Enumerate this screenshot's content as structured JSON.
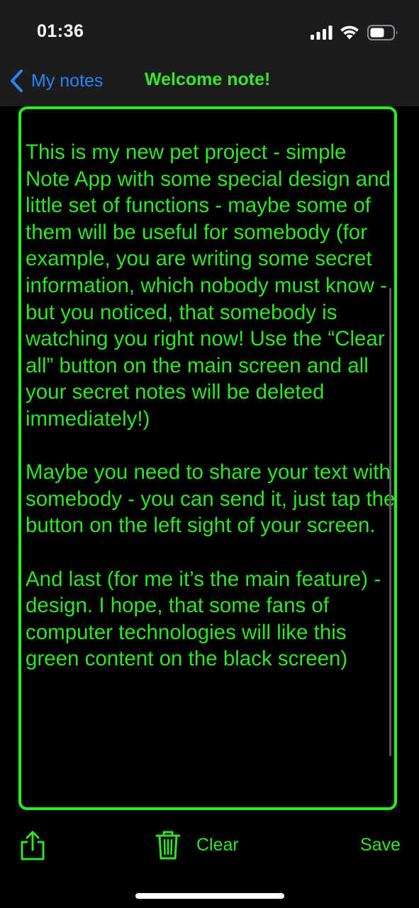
{
  "status_bar": {
    "time": "01:36",
    "icons": [
      "signal-icon",
      "wifi-icon",
      "battery-icon"
    ]
  },
  "nav": {
    "back_label": "My notes",
    "back_icon": "chevron-left-icon",
    "title": "Welcome note!"
  },
  "note": {
    "text": "This is my new pet project - simple Note App with some special design and little set of functions - maybe some of them will be useful for somebody (for example, you are writing some secret information, which nobody must know - but you noticed, that somebody is watching you right now! Use the “Clear all” button on the main screen and all your secret notes will be deleted immediately!)\n\nMaybe you need to share your text with somebody - you can send it, just tap the button on the left sight of your screen.\n\nAnd last (for me it’s the main feature) - design. I hope, that some fans of computer technologies will like this green content on the black screen)"
  },
  "toolbar": {
    "share_icon": "share-icon",
    "trash_icon": "trash-icon",
    "clear_label": "Clear",
    "save_label": "Save"
  },
  "colors": {
    "accent_green": "#2ee624",
    "border_green": "#27f020",
    "link_blue": "#2a84f6",
    "background": "#000000",
    "bar_background": "#1c1c1e"
  }
}
